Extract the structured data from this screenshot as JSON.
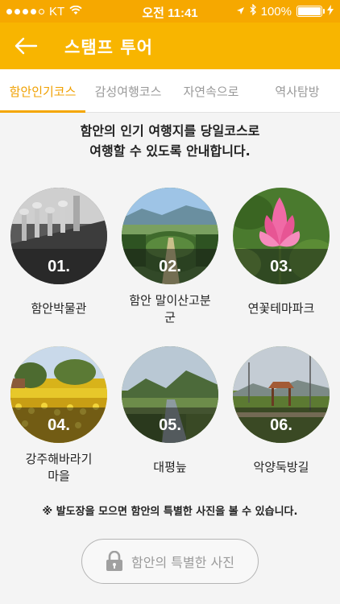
{
  "status_bar": {
    "carrier": "KT",
    "time": "오전 11:41",
    "battery": "100%",
    "battery_level": 1.0,
    "icons": [
      "signal-dots",
      "wifi-icon",
      "location-arrow-icon",
      "bluetooth-icon",
      "battery-icon",
      "charging-bolt-icon"
    ]
  },
  "header": {
    "title": "스탬프 투어",
    "back_icon": "back-arrow-icon"
  },
  "tabs": [
    {
      "label": "함안인기코스",
      "active": true
    },
    {
      "label": "감성여행코스",
      "active": false
    },
    {
      "label": "자연속으로",
      "active": false
    },
    {
      "label": "역사탐방",
      "active": false
    }
  ],
  "intro": {
    "line1": "함안의 인기 여행지를 당일코스로",
    "line2": "여행할 수 있도록 안내합니다."
  },
  "spots": [
    {
      "number": "01.",
      "name": "함안박물관"
    },
    {
      "number": "02.",
      "name": "함안 말이산고분\n군"
    },
    {
      "number": "03.",
      "name": "연꽃테마파크"
    },
    {
      "number": "04.",
      "name": "강주해바라기\n마을"
    },
    {
      "number": "05.",
      "name": "대평늪"
    },
    {
      "number": "06.",
      "name": "악양둑방길"
    }
  ],
  "notice": "※ 발도장을 모으면 함안의 특별한 사진을 볼 수 있습니다.",
  "special_photo_button": {
    "label": "함안의 특별한 사진",
    "icon": "lock-icon"
  },
  "colors": {
    "accent": "#f8b500",
    "tab_active": "#f0a000"
  }
}
